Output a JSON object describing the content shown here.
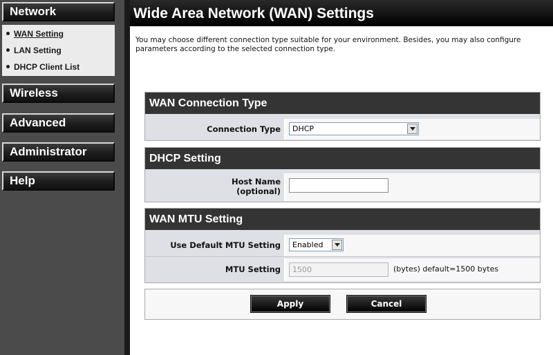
{
  "sidebar": {
    "network_label": "Network",
    "network_items": [
      {
        "label": "WAN Setting"
      },
      {
        "label": "LAN Setting"
      },
      {
        "label": "DHCP Client List"
      }
    ],
    "wireless_label": "Wireless",
    "advanced_label": "Advanced",
    "administrator_label": "Administrator",
    "help_label": "Help"
  },
  "header": {
    "title": "Wide Area Network (WAN) Settings",
    "description": "You may choose different connection type suitable for your environment. Besides, you may also configure parameters according to the selected connection type."
  },
  "wan_connection": {
    "title": "WAN Connection Type",
    "type_label": "Connection Type",
    "type_value": "DHCP"
  },
  "dhcp": {
    "title": "DHCP Setting",
    "host_label_line1": "Host Name",
    "host_label_line2": "(optional)",
    "host_value": ""
  },
  "mtu": {
    "title": "WAN MTU Setting",
    "default_label": "Use Default MTU Setting",
    "default_value": "Enabled",
    "mtu_label": "MTU Setting",
    "mtu_value": "1500",
    "mtu_hint": "(bytes) default=1500 bytes"
  },
  "actions": {
    "apply_label": "Apply",
    "cancel_label": "Cancel"
  }
}
